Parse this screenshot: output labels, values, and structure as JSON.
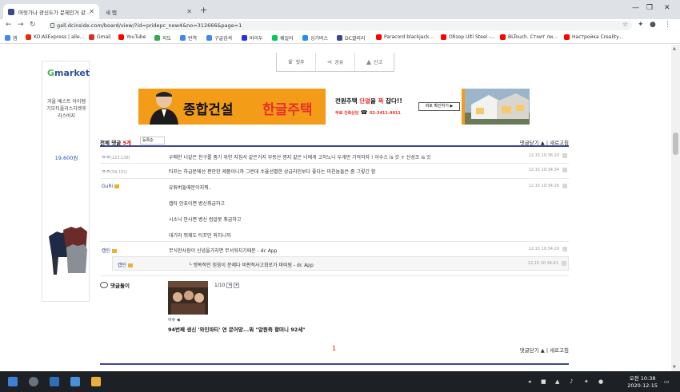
{
  "browser": {
    "tabs": [
      {
        "title": "머릿가나 광신도가 문제인거 같..."
      },
      {
        "title": "새 탭"
      }
    ],
    "new_tab": "+",
    "url": "gall.dcinside.com/board/view/?id=pridepc_new4&no=312666&page=1",
    "bookmarks": [
      "앱",
      "KO:AliExpress | alle...",
      "Gmail",
      "YouTube",
      "지도",
      "번역",
      "구글검색",
      "바이두",
      "쉐일어",
      "싱기버스",
      "DC갤러리",
      "Paracord blackjack...",
      "Обзор Ulti Steel -...",
      "BLTouch. Стоит ли...",
      "Настройка Creality..."
    ]
  },
  "colors": {
    "accent": "#3b4890",
    "banner": "#f39c17",
    "highlight": "#d31900"
  },
  "sharebar": {
    "recommend": "힛추",
    "share": "공유",
    "report": "신고"
  },
  "side_ad": {
    "brand_g": "G",
    "brand_rest": "market",
    "desc": "겨울 베스트 아이템기모티플리스자켓후리스바지",
    "price": "19,600원"
  },
  "banner": {
    "title1": "종합건설",
    "title2": "한글주택",
    "line1_pre": "전원주택",
    "line1_hi": "단열",
    "line1_mid": "을",
    "line1_hi2": "꽉",
    "line1_post": "잡다!!",
    "line2_tag": "무료 건축상담",
    "line2_phone": "02-3411-9911",
    "button": "바로 확인하기 ▶"
  },
  "comments_header": {
    "all": "전체 댓글",
    "count": "5개",
    "sort": "등록순",
    "close": "댓글닫기 ▲",
    "refresh": "새로고침"
  },
  "comments": [
    {
      "nick": "ㅇㅇ",
      "ip": "(223.138)",
      "text": "우매한 너같은 친구를 줌기 위한 지침서 같은거지 부동산 명지 같은 너에게 고하노니 두개만 기억하자 ! 아수스 is 갓 + 산성조 is 갓",
      "date": "12.15 10:36:20"
    },
    {
      "nick": "ㅇㅇ",
      "ip": "(59.151)",
      "text": "타프는 하급문에선 편안한 제품이니까 그런데 수율선별한 상급라인보다 좋다는 미친놈들은 좀 그렇긴 함",
      "date": "12.15 10:34:34"
    },
    {
      "nick": "GuRi",
      "ip": "",
      "lines": [
        "유튜버들때문이지뭐..",
        "캡타 안죠이면 병신취급하고",
        "시소닉 안사면 병신 컴알못 취급하고",
        "대기리 뷔제도 티프만 외치니까"
      ],
      "date": "12.15 10:34:26"
    },
    {
      "nick": "캡틴",
      "ip": "",
      "text": "무식한사람이 신념을가지면 무서워지기때문 - dc App",
      "date": "12.15 10:34:29"
    }
  ],
  "reply": {
    "nick": "캡틴",
    "text": "└  맹목적인 믿음이 문제다 비판적사고회로가 마비됨 - dc App",
    "date": "12.15 10:34:41"
  },
  "dory": {
    "label": "댓글돌이",
    "page": "1/10",
    "prev": "◂",
    "next": "▸",
    "caption_small": "이슈 ◀",
    "caption": "94번째 생신 '와인파티' 연 문어망...뭐 \"알뭔죽 할머니 92세\""
  },
  "footer": {
    "page": "1",
    "close": "댓글닫기 ▲",
    "refresh": "새로고침"
  },
  "taskbar": {
    "time": "오전 10:38",
    "date": "2020-12-15"
  }
}
